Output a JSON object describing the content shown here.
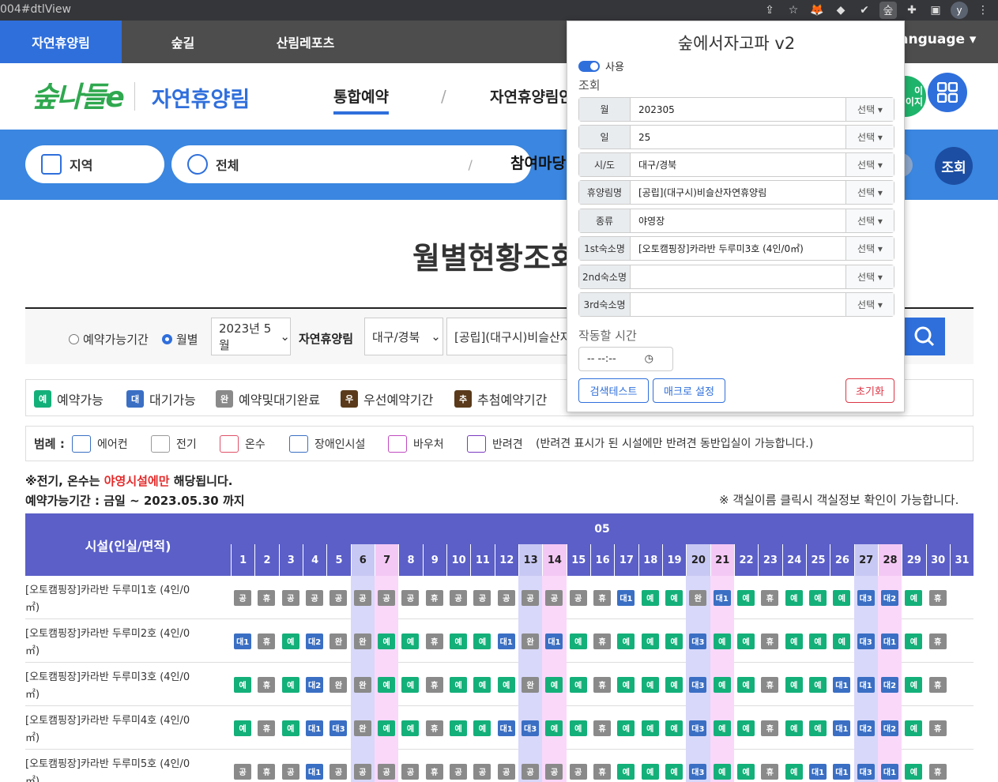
{
  "browser": {
    "url": "004#dtlView"
  },
  "topnav": {
    "tabs": [
      "자연휴양림",
      "숲길",
      "산림레포츠"
    ],
    "language": "anguage ▾"
  },
  "header": {
    "logo": "숲나들e",
    "subtitle": "자연휴양림",
    "menu": [
      "통합예약",
      "자연휴양림안"
    ],
    "green_btn": "이\n이지"
  },
  "search": {
    "region": "지역",
    "all": "전체",
    "participate": "참여마당",
    "query_btn": "조회"
  },
  "page": {
    "title": "월별현황조회"
  },
  "filter": {
    "radio1": "예약가능기간",
    "radio2": "월별",
    "month": "2023년 5월",
    "label": "자연휴양림",
    "sido": "대구/경북",
    "forest": "[공립](대구시)비슬산자"
  },
  "status": [
    {
      "code": "예",
      "label": "예약가능",
      "color": "#14b07a"
    },
    {
      "code": "대",
      "label": "대기가능",
      "color": "#3a6fc4"
    },
    {
      "code": "완",
      "label": "예약및대기완료",
      "color": "#8a8a8a"
    },
    {
      "code": "우",
      "label": "우선예약기간",
      "color": "#5a3a1a"
    },
    {
      "code": "추",
      "label": "추첨예약기간",
      "color": "#5a3a1a"
    }
  ],
  "legend": {
    "title": "범례 :",
    "items": [
      "에어컨",
      "전기",
      "온수",
      "장애인시설",
      "바우처",
      "반려견"
    ],
    "note": "(반려견 표시가 된 시설에만 반려견 동반입실이 가능합니다.)"
  },
  "notes": {
    "line1_a": "※전기, 온수는 ",
    "line1_red": "야영시설에만",
    "line1_b": " 해당됩니다.",
    "line2": "예약가능기간 : 금일 ~ 2023.05.30 까지",
    "line3": "※ 객실이름 클릭시 객실정보 확인이 가능합니다."
  },
  "table": {
    "fac_header": "시설(인실/면적)",
    "month": "05",
    "days": [
      "1",
      "2",
      "3",
      "4",
      "5",
      "6",
      "7",
      "8",
      "9",
      "10",
      "11",
      "12",
      "13",
      "14",
      "15",
      "16",
      "17",
      "18",
      "19",
      "20",
      "21",
      "22",
      "23",
      "24",
      "25",
      "26",
      "27",
      "28",
      "29",
      "30",
      "31"
    ],
    "rows": [
      {
        "name": "[오토캠핑장]카라반 두루미1호 (4인/0",
        "name2": "㎡)",
        "cells": [
          "공",
          "휴",
          "공",
          "공",
          "공",
          "공",
          "공",
          "공",
          "휴",
          "공",
          "공",
          "공",
          "공",
          "공",
          "공",
          "휴",
          "대1",
          "예",
          "예",
          "완",
          "대1",
          "예",
          "휴",
          "예",
          "예",
          "예",
          "대3",
          "대2",
          "예",
          "휴",
          ""
        ]
      },
      {
        "name": "[오토캠핑장]카라반 두루미2호 (4인/0",
        "name2": "㎡)",
        "cells": [
          "대1",
          "휴",
          "예",
          "대2",
          "완",
          "완",
          "예",
          "예",
          "휴",
          "예",
          "예",
          "대1",
          "완",
          "대1",
          "예",
          "휴",
          "예",
          "예",
          "예",
          "대3",
          "예",
          "예",
          "휴",
          "예",
          "예",
          "예",
          "대3",
          "대1",
          "예",
          "휴",
          ""
        ]
      },
      {
        "name": "[오토캠핑장]카라반 두루미3호 (4인/0",
        "name2": "㎡)",
        "cells": [
          "예",
          "휴",
          "예",
          "대2",
          "완",
          "완",
          "예",
          "예",
          "휴",
          "예",
          "예",
          "예",
          "완",
          "예",
          "예",
          "휴",
          "예",
          "예",
          "예",
          "대3",
          "예",
          "예",
          "휴",
          "예",
          "예",
          "대1",
          "대1",
          "대2",
          "예",
          "휴",
          ""
        ]
      },
      {
        "name": "[오토캠핑장]카라반 두루미4호 (4인/0",
        "name2": "㎡)",
        "cells": [
          "예",
          "휴",
          "예",
          "대1",
          "대3",
          "완",
          "예",
          "예",
          "휴",
          "예",
          "예",
          "대1",
          "대3",
          "예",
          "예",
          "휴",
          "예",
          "예",
          "예",
          "대3",
          "예",
          "예",
          "휴",
          "예",
          "예",
          "대1",
          "대2",
          "대2",
          "예",
          "휴",
          ""
        ]
      },
      {
        "name": "[오토캠핑장]카라반 두루미5호 (4인/0",
        "name2": "㎡)",
        "cells": [
          "공",
          "휴",
          "공",
          "대1",
          "공",
          "공",
          "공",
          "공",
          "휴",
          "공",
          "공",
          "공",
          "공",
          "공",
          "공",
          "휴",
          "예",
          "예",
          "예",
          "대3",
          "예",
          "예",
          "휴",
          "예",
          "대1",
          "대1",
          "대3",
          "대1",
          "예",
          "휴",
          ""
        ]
      }
    ]
  },
  "popup": {
    "title": "숲에서자고파 v2",
    "toggle_label": "사용",
    "section": "조회",
    "fields": [
      {
        "label": "월",
        "value": "202305",
        "pick": "선택 ▾"
      },
      {
        "label": "일",
        "value": "25",
        "pick": "선택 ▾"
      },
      {
        "label": "시/도",
        "value": "대구/경북",
        "pick": "선택 ▾"
      },
      {
        "label": "휴양림명",
        "value": "[공립](대구시)비슬산자연휴양림",
        "pick": "선택 ▾"
      },
      {
        "label": "종류",
        "value": "야영장",
        "pick": "선택 ▾"
      },
      {
        "label": "1st숙소명",
        "value": "[오토캠핑장]카라반 두루미3호 (4인/0㎡)",
        "pick": "선택 ▾"
      },
      {
        "label": "2nd숙소명",
        "value": "",
        "pick": "선택 ▾"
      },
      {
        "label": "3rd숙소명",
        "value": "",
        "pick": "선택 ▾"
      }
    ],
    "time_label": "작동할 시간",
    "time_value": "-- --:--",
    "btn_test": "검색테스트",
    "btn_macro": "매크로 설정",
    "btn_reset": "초기화"
  }
}
